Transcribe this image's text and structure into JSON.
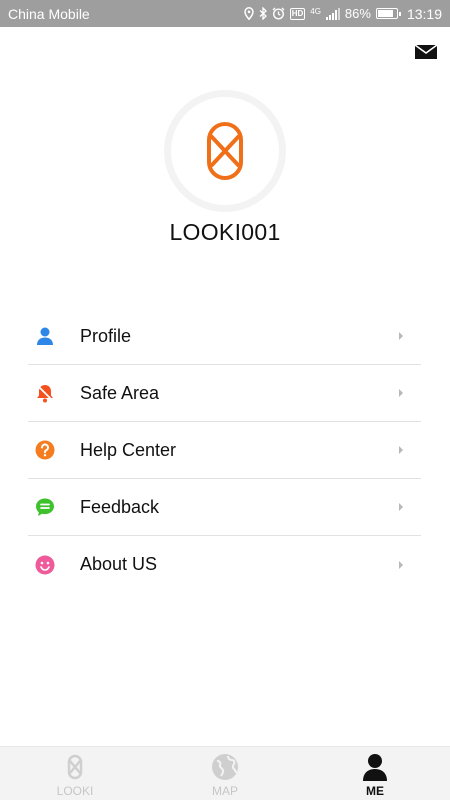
{
  "status_bar": {
    "carrier": "China Mobile",
    "hd": "HD",
    "network": "4G",
    "battery": "86%",
    "battery_level": 0.86,
    "time": "13:19"
  },
  "profile": {
    "username": "LOOKI001",
    "accent_color": "#f07019"
  },
  "menu": {
    "items": [
      {
        "label": "Profile",
        "icon": "person-icon",
        "color": "#2e86e6"
      },
      {
        "label": "Safe Area",
        "icon": "bell-icon",
        "color": "#f4511e"
      },
      {
        "label": "Help Center",
        "icon": "question-icon",
        "color": "#f57c1f"
      },
      {
        "label": "Feedback",
        "icon": "chat-icon",
        "color": "#3fc12e"
      },
      {
        "label": "About US",
        "icon": "smiley-icon",
        "color": "#ee5a9a"
      }
    ]
  },
  "bottom_nav": {
    "tabs": [
      {
        "label": "LOOKI",
        "icon": "looki-icon",
        "active": false
      },
      {
        "label": "MAP",
        "icon": "globe-icon",
        "active": false
      },
      {
        "label": "ME",
        "icon": "person-icon",
        "active": true
      }
    ]
  }
}
